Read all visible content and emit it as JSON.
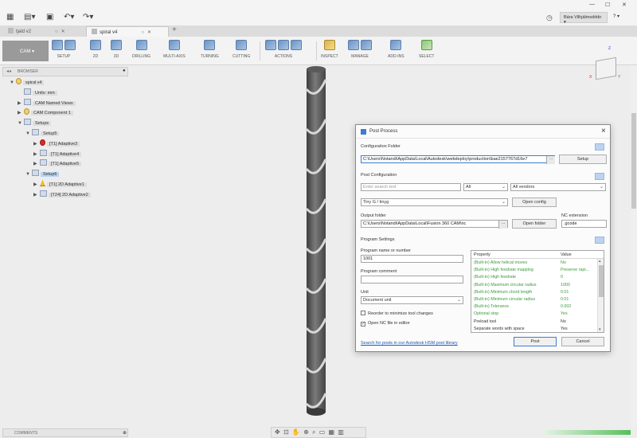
{
  "window": {
    "user": "Bára Vilhjálmsdóttir",
    "help": "?"
  },
  "tabs": [
    {
      "label": "tjald v2"
    },
    {
      "label": "spiral v4"
    }
  ],
  "toolbar": {
    "workspace": "CAM",
    "groups": [
      "SETUP",
      "2D",
      "3D",
      "DRILLING",
      "MULTI-AXIS",
      "TURNING",
      "CUTTING",
      "ACTIONS",
      "INSPECT",
      "MANAGE",
      "ADD-INS",
      "SELECT"
    ]
  },
  "browser": {
    "title": "BROWSER",
    "items": [
      {
        "label": "spiral v4",
        "level": 0,
        "expand": "▼",
        "icon": "bulb"
      },
      {
        "label": "Units: mm",
        "level": 1,
        "expand": "",
        "icon": "doc"
      },
      {
        "label": "CAM Named Views",
        "level": 1,
        "expand": "▶",
        "icon": "folder"
      },
      {
        "label": "CAM Component 1",
        "level": 1,
        "expand": "▶",
        "icon": "bulb"
      },
      {
        "label": "Setups",
        "level": 1,
        "expand": "▼",
        "icon": "folder"
      },
      {
        "label": "Setup5",
        "level": 2,
        "expand": "▼",
        "icon": "folder"
      },
      {
        "label": "[T1] Adaptive3",
        "level": 3,
        "expand": "▶",
        "icon": "err"
      },
      {
        "label": "[T1] Adaptive4",
        "level": 3,
        "expand": "▶",
        "icon": "op"
      },
      {
        "label": "[T1] Adaptive5",
        "level": 3,
        "expand": "▶",
        "icon": "op"
      },
      {
        "label": "Setup6",
        "level": 2,
        "expand": "▼",
        "icon": "folder",
        "selected": true
      },
      {
        "label": "[T1] 2D Adaptive1",
        "level": 3,
        "expand": "▶",
        "icon": "warn"
      },
      {
        "label": "[T24] 2D Adaptive2",
        "level": 3,
        "expand": "▶",
        "icon": "op"
      }
    ]
  },
  "comments": {
    "title": "COMMENTS"
  },
  "viewcube": {
    "x": "X",
    "y": "Y",
    "z": "Z"
  },
  "dialog": {
    "title": "Post Process",
    "config_folder_label": "Configuration Folder",
    "config_folder_value": "C:\\Users\\Notandi\\AppData\\Local\\Autodesk\\webdeploy\\production\\bae2157767d16e7",
    "setup_btn": "Setup",
    "post_config_label": "Post Configuration",
    "search_placeholder": "Enter search text",
    "filter_all": "All",
    "filter_vendors": "All vendors",
    "post_selected": "Tiny G / tinyg",
    "open_config_btn": "Open config",
    "output_folder_label": "Output folder",
    "output_folder_value": "C:\\Users\\Notandi\\AppData\\Local\\Fusion 360 CAM\\nc",
    "open_folder_btn": "Open folder",
    "nc_ext_label": "NC extension",
    "nc_ext_value": ".gcode",
    "program_settings_label": "Program Settings",
    "program_name_label": "Program name or number",
    "program_name_value": "1001",
    "program_comment_label": "Program comment",
    "unit_label": "Unit",
    "unit_value": "Document unit",
    "reorder_label": "Reorder to minimize tool changes",
    "open_nc_label": "Open NC file in editor",
    "link": "Search for posts in our Autodesk HSM post library",
    "post_btn": "Post",
    "cancel_btn": "Cancel",
    "table": {
      "col_property": "Property",
      "col_value": "Value",
      "rows": [
        {
          "p": "(Built-in) Allow helical moves",
          "v": "No",
          "builtin": true
        },
        {
          "p": "(Built-in) High feedrate mapping",
          "v": "Preserve rapi...",
          "builtin": true
        },
        {
          "p": "(Built-in) High feedrate",
          "v": "0",
          "builtin": true
        },
        {
          "p": "(Built-in) Maximum circular radius",
          "v": "1000",
          "builtin": true
        },
        {
          "p": "(Built-in) Minimum chord length",
          "v": "0.01",
          "builtin": true
        },
        {
          "p": "(Built-in) Minimum circular radius",
          "v": "0.01",
          "builtin": true
        },
        {
          "p": "(Built-in) Tolerance",
          "v": "0.002",
          "builtin": true
        },
        {
          "p": "Optional stop",
          "v": "Yes",
          "builtin": true
        },
        {
          "p": "Preload tool",
          "v": "No",
          "builtin": false
        },
        {
          "p": "Separate words with space",
          "v": "Yes",
          "builtin": false
        }
      ]
    }
  },
  "colors": {
    "accent": "#3c7dd0",
    "builtin_text": "#3b9a3b",
    "tool_body": "#5c5c5c"
  }
}
